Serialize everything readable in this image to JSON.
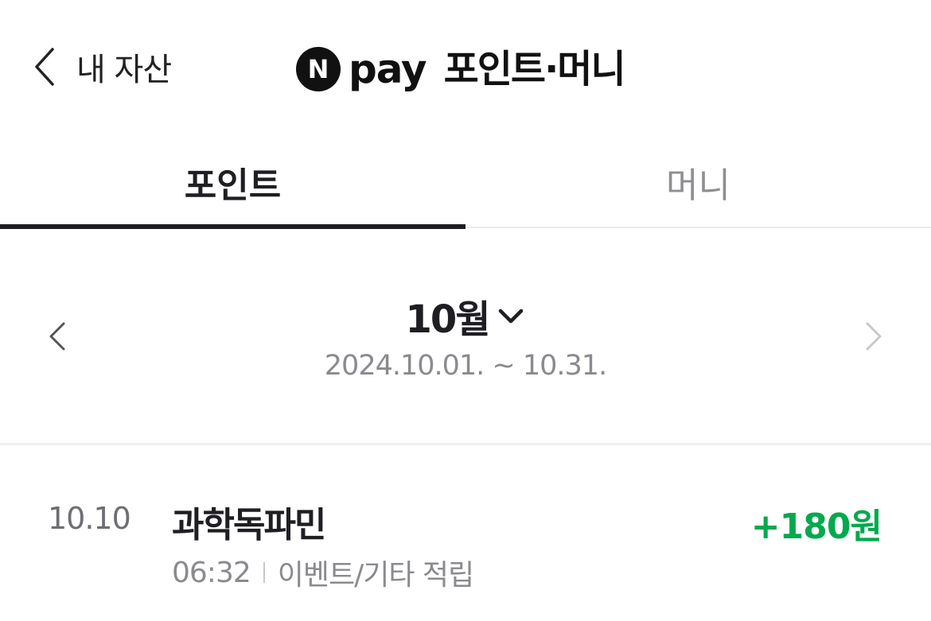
{
  "header": {
    "back_label": "내 자산",
    "logo_letter": "N",
    "pay_word": "pay",
    "title": "포인트·머니"
  },
  "tabs": [
    {
      "label": "포인트",
      "active": true
    },
    {
      "label": "머니",
      "active": false
    }
  ],
  "month_nav": {
    "month_label": "10월",
    "date_range": "2024.10.01. ~ 10.31."
  },
  "transactions": [
    {
      "date": "10.10",
      "title": "과학독파민",
      "amount": "+180원",
      "time": "06:32",
      "type": "이벤트/기타 적립"
    }
  ],
  "colors": {
    "accent_text": "#1e1e23",
    "positive_amount": "#03a94d",
    "muted_text": "#8a8a8f"
  },
  "icons": {
    "back": "chevron-left-icon",
    "month_dropdown": "chevron-down-icon",
    "prev_month": "chevron-left-icon",
    "next_month": "chevron-right-icon"
  }
}
